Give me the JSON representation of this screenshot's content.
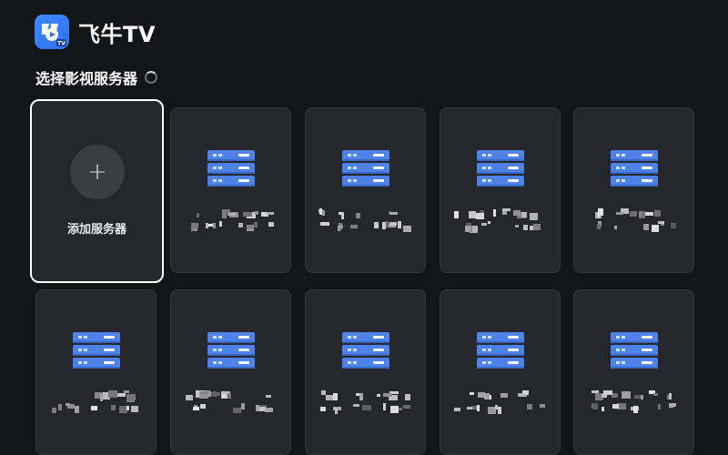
{
  "app": {
    "brand": "飞牛TV",
    "logo_icon": "fnos-tv-logo-icon"
  },
  "section": {
    "title": "选择影视服务器",
    "loading_icon": "loading-spinner-icon"
  },
  "add_card": {
    "label": "添加服务器",
    "icon": "plus-icon"
  },
  "servers": [
    {
      "icon": "server-icon"
    },
    {
      "icon": "server-icon"
    },
    {
      "icon": "server-icon"
    },
    {
      "icon": "server-icon"
    },
    {
      "icon": "server-icon"
    },
    {
      "icon": "server-icon"
    },
    {
      "icon": "server-icon"
    },
    {
      "icon": "server-icon"
    },
    {
      "icon": "server-icon"
    }
  ],
  "colors": {
    "background": "#141519",
    "card": "#26272c",
    "accent": "#4f82e8",
    "focus_border": "#ffffff"
  }
}
